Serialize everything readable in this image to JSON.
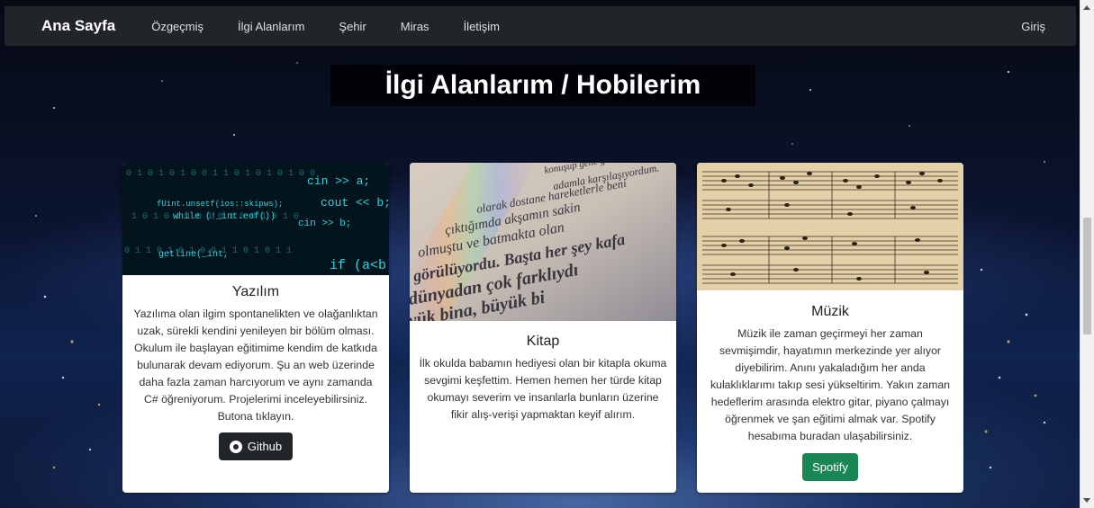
{
  "nav": {
    "brand": "Ana Sayfa",
    "items": [
      {
        "label": "Özgeçmiş"
      },
      {
        "label": "İlgi Alanlarım"
      },
      {
        "label": "Şehir"
      },
      {
        "label": "Miras"
      },
      {
        "label": "İletişim"
      }
    ],
    "login": "Giriş"
  },
  "page_title": "İlgi Alanlarım / Hobilerim",
  "cards": [
    {
      "image_alt": "code-background-image",
      "title": "Yazılım",
      "text": "Yazılıma olan ilgim spontanelikten ve olağanlıktan uzak, sürekli kendini yenileyen bir bölüm olması. Okulum ile başlayan eğitimime kendim de katkıda bulunarak devam ediyorum. Şu an web üzerinde daha fazla zaman harcıyorum ve aynı zamanda C# öğreniyorum. Projelerimi inceleyebilirsiniz. Butona tıklayın.",
      "button": "Github",
      "code_lines": [
        "cin >> a;",
        "cout << b;",
        "cin >> b;",
        "if (a<b)",
        "getline(_int,",
        "while (!_int.eof())",
        "fUint.unsetf(ios::skipws);"
      ]
    },
    {
      "image_alt": "book-page-image",
      "title": "Kitap",
      "text": "İlk okulda babamın hediyesi olan bir kitapla okuma sevgimi keşfettim. Hemen hemen her türde kitap okumayı severim ve insanlarla bunların üzerine fikir alış-verişi yapmaktan keyif alırım.",
      "book_lines": [
        "konuşup gene gittikçe",
        "adamla karşılaşıyordum.",
        "olarak dostane hareketlerle beni",
        "çıktığımda akşamın sakin",
        "olmuştu ve batmakta olan",
        "görülüyordu. Başta her şey kafa",
        "dünyadan çok farklıydı",
        "yük bina, büyük bi"
      ]
    },
    {
      "image_alt": "sheet-music-image",
      "title": "Müzik",
      "text": "Müzik ile zaman geçirmeyi her zaman sevmişimdir, hayatımın merkezinde yer alıyor diyebilirim. Anını yakaladığım her anda kulaklıklarımı takıp sesi yükseltirim. Yakın zaman hedeflerim arasında elektro gitar, piyano çalmayı öğrenmek ve şan eğitimi almak var. Spotify hesabıma buradan ulaşabilirsiniz.",
      "button": "Spotify"
    }
  ],
  "colors": {
    "navbar": "#212529",
    "github_button": "#212529",
    "spotify_button": "#198754",
    "code_text": "#29d6e0"
  }
}
